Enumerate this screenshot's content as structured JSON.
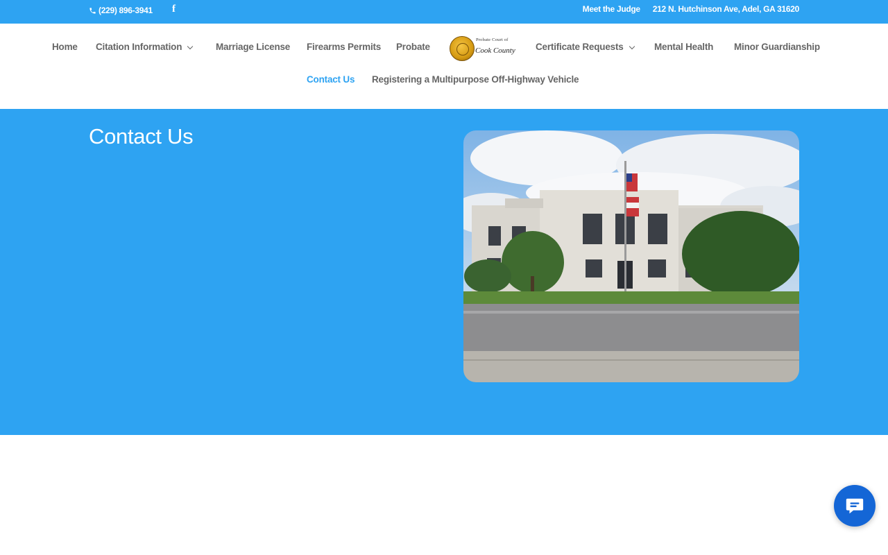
{
  "topbar": {
    "phone": "(229) 896-3941",
    "facebook_icon": "facebook-icon",
    "meet_judge": "Meet the Judge",
    "address": "212 N. Hutchinson Ave, Adel, GA 31620"
  },
  "nav": {
    "home": "Home",
    "citation": "Citation Information",
    "marriage": "Marriage License",
    "firearms": "Firearms Permits",
    "probate": "Probate",
    "certificate": "Certificate Requests",
    "mental": "Mental Health",
    "minor": "Minor Guardianship",
    "contact": "Contact Us",
    "ohv": "Registering a Multipurpose Off-Highway Vehicle"
  },
  "logo": {
    "line1": "Probate Court of",
    "line2": "Cook County"
  },
  "hero": {
    "title": "Contact Us"
  },
  "colors": {
    "brand_blue": "#2ea3f2",
    "chat_blue": "#1466d6",
    "nav_text": "#666666"
  },
  "chat": {
    "icon": "chat-bubble-icon"
  }
}
